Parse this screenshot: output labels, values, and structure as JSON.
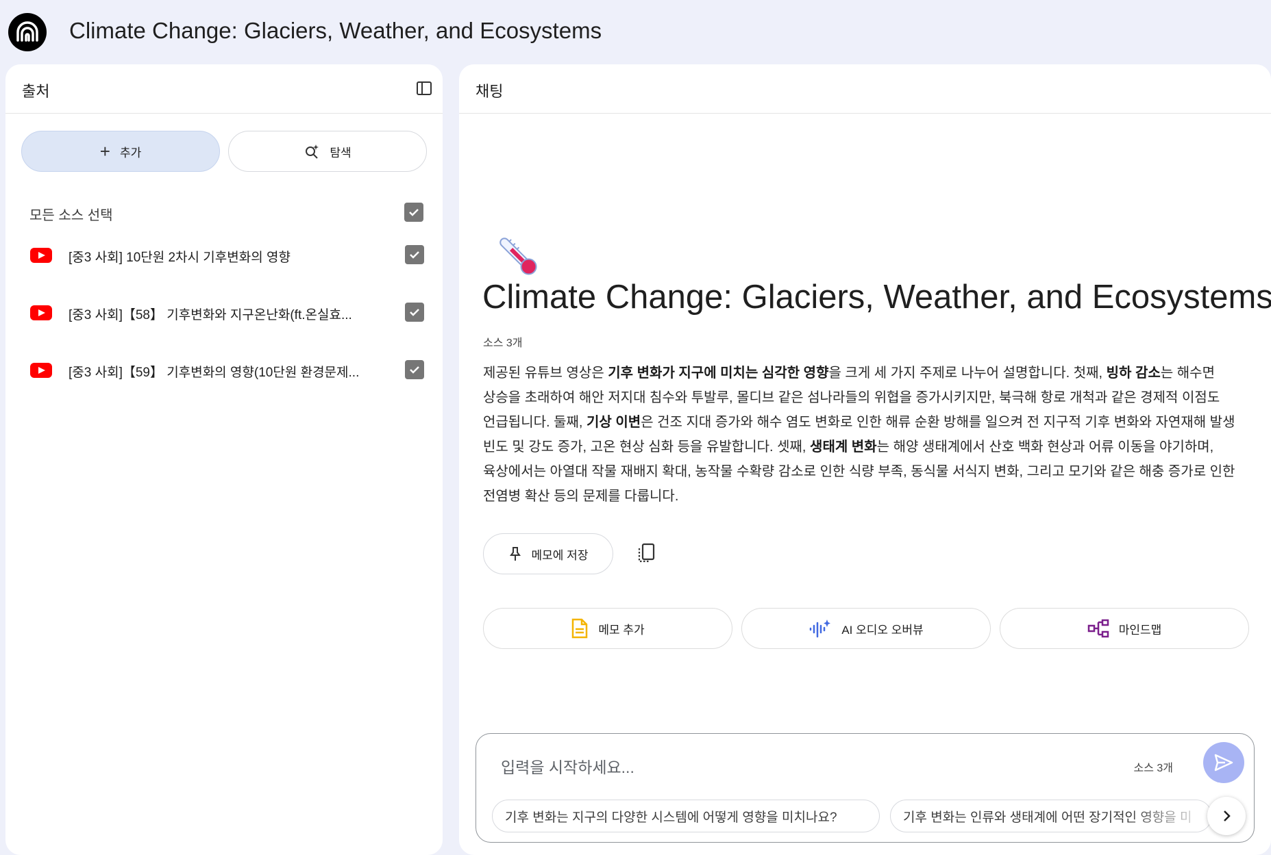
{
  "header": {
    "title": "Climate Change: Glaciers, Weather, and Ecosystems",
    "logo_icon": "notebook-logo-icon"
  },
  "sources_panel": {
    "title": "출처",
    "add_label": "추가",
    "explore_label": "탐색",
    "select_all_label": "모든 소스 선택",
    "items": [
      {
        "label": "[중3 사회] 10단원 2차시 기후변화의 영향",
        "icon": "youtube-icon",
        "checked": true
      },
      {
        "label": "[중3 사회]【58】 기후변화와 지구온난화(ft.온실효...",
        "icon": "youtube-icon",
        "checked": true
      },
      {
        "label": "[중3 사회]【59】 기후변화의 영향(10단원 환경문제...",
        "icon": "youtube-icon",
        "checked": true
      }
    ]
  },
  "chat_panel": {
    "title": "채팅",
    "emoji_icon": "thermometer-icon",
    "notebook_title": "Climate Change: Glaciers, Weather, and Ecosystems",
    "source_count": "소스 3개",
    "summary": {
      "p1": "제공된 유튜브 영상은 ",
      "b1": "기후 변화가 지구에 미치는 심각한 영향",
      "p2": "을 크게 세 가지 주제로 나누어 설명합니다. 첫째, ",
      "b2": "빙하 감소",
      "p3": "는 해수면 상승을 초래하여 해안 저지대 침수와 투발루, 몰디브 같은 섬나라들의 위협을 증가시키지만, 북극해 항로 개척과 같은 경제적 이점도 언급됩니다. 둘째, ",
      "b3": "기상 이변",
      "p4": "은 건조 지대 증가와 해수 염도 변화로 인한 해류 순환 방해를 일으켜 전 지구적 기후 변화와 자연재해 발생 빈도 및 강도 증가, 고온 현상 심화 등을 유발합니다. 셋째, ",
      "b4": "생태계 변화",
      "p5": "는 해양 생태계에서 산호 백화 현상과 어류 이동을 야기하며, 육상에서는 아열대 작물 재배지 확대, 농작물 수확량 감소로 인한 식량 부족, 동식물 서식지 변화, 그리고 모기와 같은 해충 증가로 인한 전염병 확산 등의 문제를 다룹니다."
    },
    "save_memo_label": "메모에 저장",
    "actions": [
      {
        "label": "메모 추가",
        "icon": "note-icon"
      },
      {
        "label": "AI 오디오 오버뷰",
        "icon": "audio-sparkle-icon"
      },
      {
        "label": "마인드맵",
        "icon": "mindmap-icon"
      }
    ],
    "input": {
      "placeholder": "입력을 시작하세요...",
      "source_count": "소스 3개"
    },
    "suggestions": [
      "기후 변화는 지구의 다양한 시스템에 어떻게 영향을 미치나요?",
      "기후 변화는 인류와 생태계에 어떤 장기적인 영향을 미"
    ]
  },
  "colors": {
    "background": "#eef0fa",
    "add_button": "#dde6f6",
    "send_button": "#a8b4f4",
    "youtube_red": "#ff0000",
    "memo_icon": "#f4b400",
    "audio_icon": "#4169e1",
    "mindmap_icon": "#7b1f8c"
  }
}
